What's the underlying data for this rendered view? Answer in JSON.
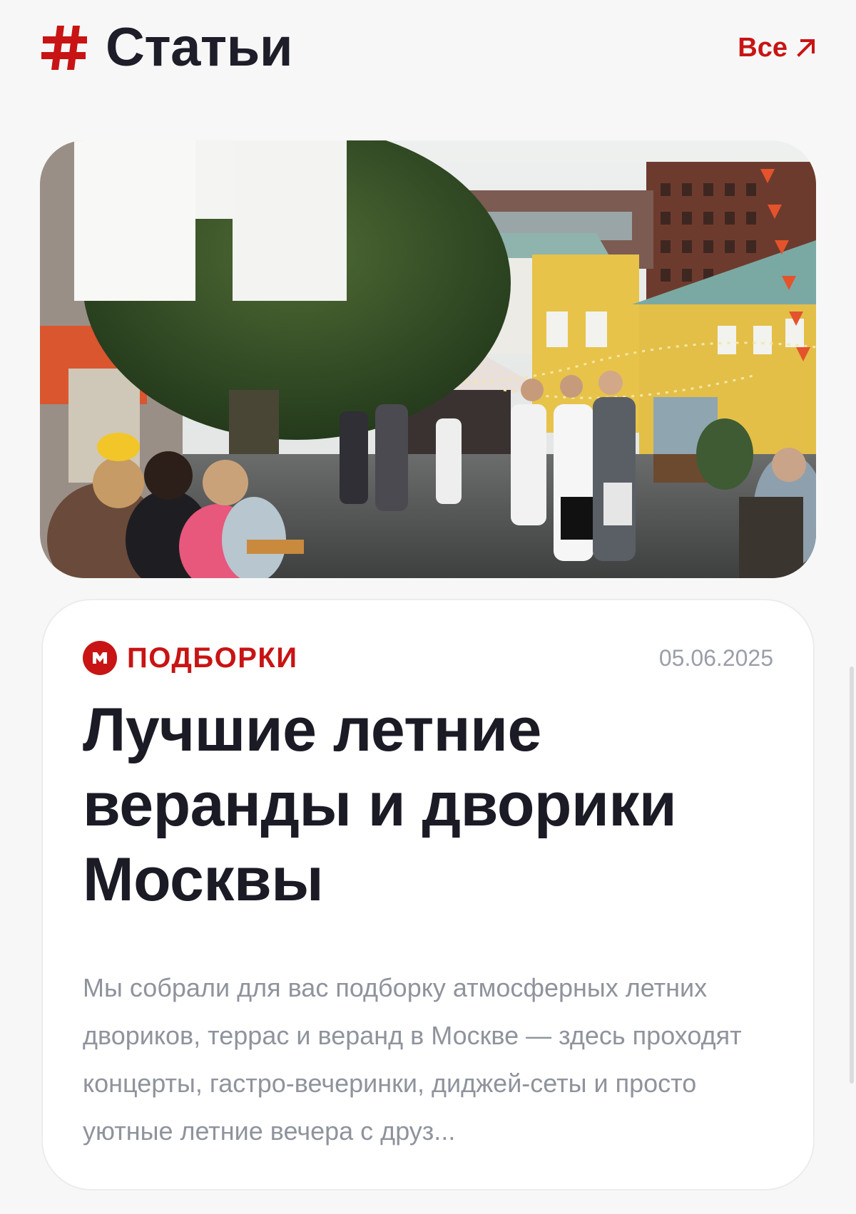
{
  "header": {
    "title": "Статьи",
    "all_link_label": "Все",
    "hash_icon": "hash-icon",
    "arrow_icon": "arrow-up-right-icon"
  },
  "article": {
    "image_alt": "Летний дворик в Москве",
    "category_icon": "category-logo-icon",
    "category": "ПОДБОРКИ",
    "date": "05.06.2025",
    "title": "Лучшие летние веранды и дворики Москвы",
    "excerpt": "Мы собрали для вас подборку атмосферных летних двориков, террас и веранд в Москве — здесь проходят концерты, гастро-вечеринки, диджей-сеты и просто уютные летние вечера с друз..."
  },
  "colors": {
    "accent": "#c81414",
    "title": "#1e1e2a",
    "muted": "#8f939c",
    "background": "#f7f7f7",
    "card": "#ffffff"
  }
}
